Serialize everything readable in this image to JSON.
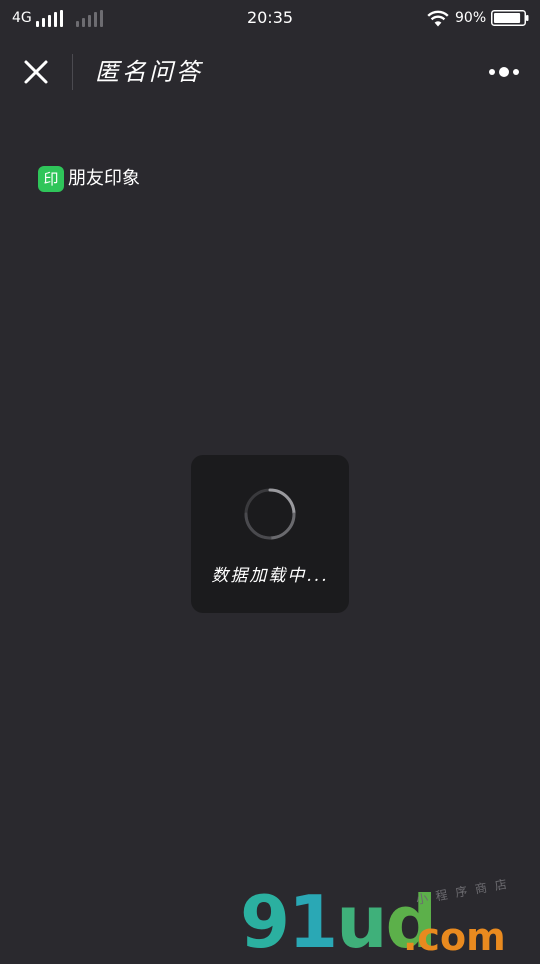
{
  "status_bar": {
    "network": "4G",
    "time": "20:35",
    "battery_percent": "90%",
    "battery_level": 0.9,
    "signal_primary_bars": 5,
    "signal_secondary_bars": 0
  },
  "nav": {
    "title": "匿名问答",
    "close_icon": "close-icon",
    "more_icon": "more-dots-icon"
  },
  "source": {
    "icon_char": "印",
    "label": "朋友印象",
    "icon_color": "#2fc55a"
  },
  "loading": {
    "text": "数据加载中..."
  },
  "watermark": {
    "main": "91ud",
    "domain": ".com",
    "sub": "小程序商店"
  },
  "colors": {
    "background": "#2a292e",
    "toast": "#1b1b1d",
    "accent_green": "#2fc55a"
  }
}
